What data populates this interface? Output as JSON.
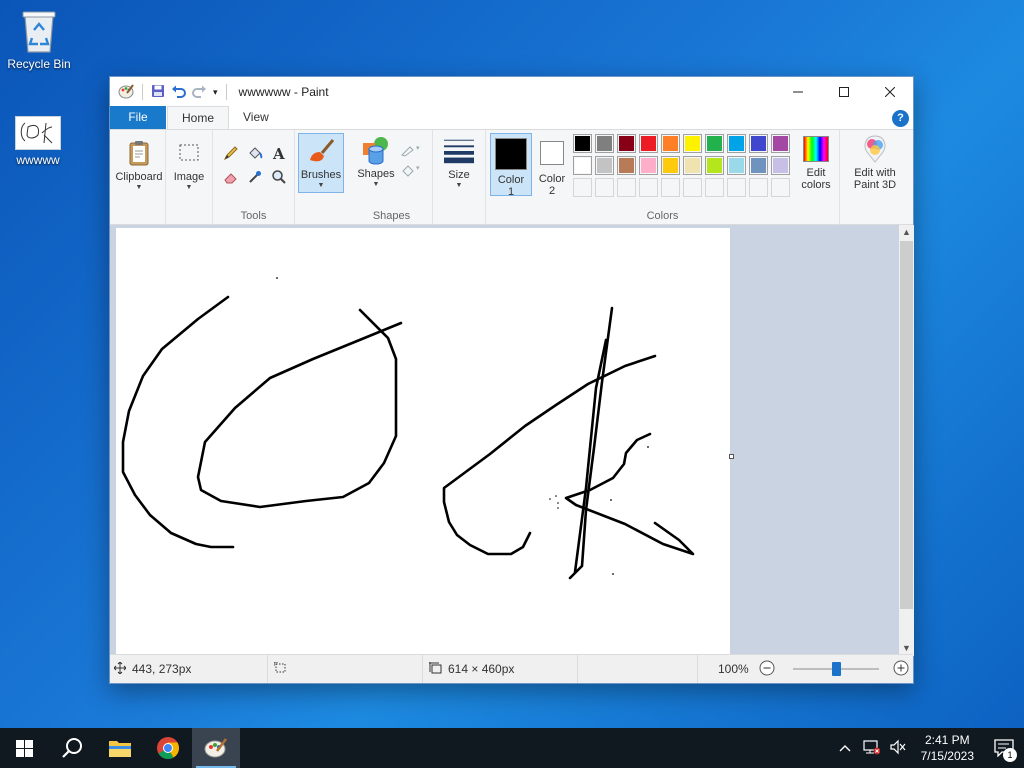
{
  "desktop": {
    "icons": [
      {
        "label": "Recycle Bin"
      },
      {
        "label": "wwwww"
      }
    ]
  },
  "window": {
    "title": "wwwwww - Paint",
    "tabs": [
      "File",
      "Home",
      "View"
    ],
    "help_label": "?"
  },
  "ribbon": {
    "clipboard_label": "Clipboard",
    "image_label": "Image",
    "tools_group_label": "Tools",
    "brushes_label": "Brushes",
    "shapes_label": "Shapes",
    "shapes_group_label": "Shapes",
    "size_label": "Size",
    "color1_label": "Color\n1",
    "color1_line1": "Color",
    "color1_line2": "1",
    "color2_line1": "Color",
    "color2_line2": "2",
    "colors_group_label": "Colors",
    "edit_colors_line1": "Edit",
    "edit_colors_line2": "colors",
    "paint3d_line1": "Edit with",
    "paint3d_line2": "Paint 3D",
    "color1_value": "#000000",
    "color2_value": "#ffffff",
    "palette_row1": [
      "#000000",
      "#7f7f7f",
      "#880015",
      "#ed1c24",
      "#ff7f27",
      "#fff200",
      "#22b14c",
      "#00a2e8",
      "#3f48cc",
      "#a349a4"
    ],
    "palette_row2": [
      "#ffffff",
      "#c3c3c3",
      "#b97a57",
      "#ffaec9",
      "#ffc90e",
      "#efe4b0",
      "#b5e61d",
      "#99d9ea",
      "#7092be",
      "#c8bfe7"
    ],
    "palette_row3": [
      "#f5f6f7",
      "#f5f6f7",
      "#f5f6f7",
      "#f5f6f7",
      "#f5f6f7",
      "#f5f6f7",
      "#f5f6f7",
      "#f5f6f7",
      "#f5f6f7",
      "#f5f6f7"
    ]
  },
  "status": {
    "cursor_pos": "443, 273px",
    "selection_size": "",
    "image_size": "614 × 460px",
    "zoom": "100%",
    "zoom_level": 0.5
  },
  "taskbar": {
    "time": "2:41 PM",
    "date": "7/15/2023",
    "notification_count": "1"
  }
}
